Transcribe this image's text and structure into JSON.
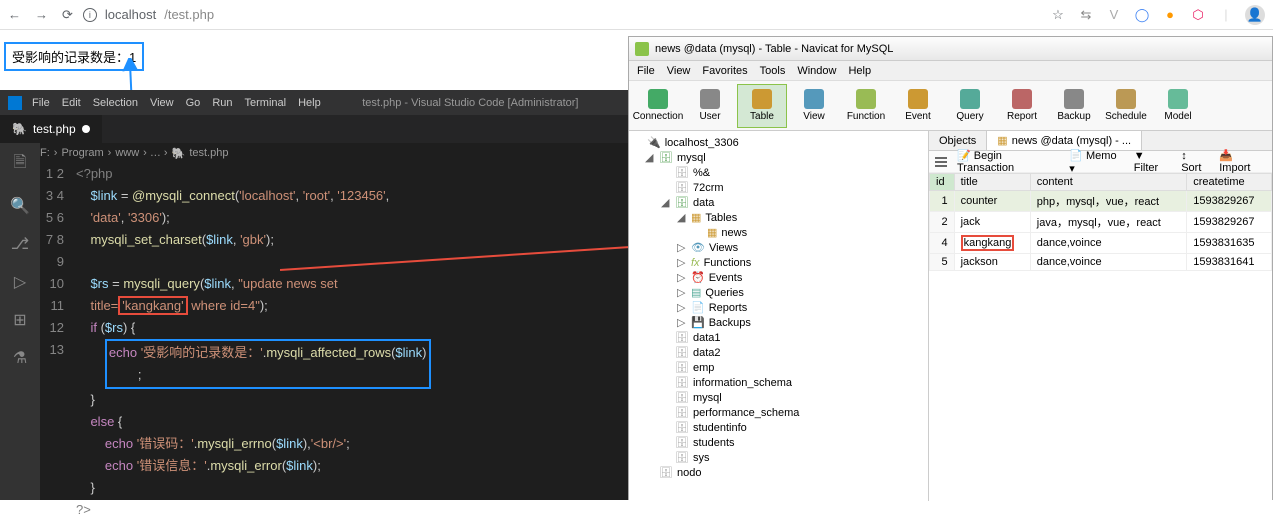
{
  "browser": {
    "url_host": "localhost",
    "url_path": "/test.php",
    "result_text": "受影响的记录数是：1"
  },
  "vscode": {
    "menu": [
      "File",
      "Edit",
      "Selection",
      "View",
      "Go",
      "Run",
      "Terminal",
      "Help"
    ],
    "title": "test.php - Visual Studio Code [Administrator]",
    "tab": "test.php",
    "breadcrumb": [
      "F:",
      "Program",
      "www",
      "",
      "test.php"
    ],
    "lines": {
      "l1": "<?php",
      "l2a": "$link",
      "l2b": " = ",
      "l2c": "@mysqli_connect",
      "l2d": "(",
      "l2s1": "'localhost'",
      "l2s2": "'root'",
      "l2s3": "'123456'",
      "l2x1": "'data'",
      "l2x2": "'3306'",
      "l2e": ");",
      "l3a": "mysqli_set_charset",
      "l3b": "(",
      "l3c": "$link",
      "l3d": ", ",
      "l3s": "'gbk'",
      "l3e": ");",
      "l5a": "$rs",
      "l5b": " = ",
      "l5c": "mysqli_query",
      "l5d": "(",
      "l5e": "$link",
      "l5f": ", ",
      "l5s": "\"update news set",
      "l5t1": "title=",
      "l5hl": "'kangkang'",
      "l5t2": " where id=4\"",
      "l5t3": ");",
      "l6a": "if",
      "l6b": " (",
      "l6c": "$rs",
      "l6d": ") {",
      "l7a": "echo ",
      "l7s": "'受影响的记录数是：'",
      "l7b": ".",
      "l7c": "mysqli_affected_rows",
      "l7d": "(",
      "l7e": "$link",
      "l7f": ")",
      "l7g": ";",
      "l8": "}",
      "l9a": "else",
      "l9b": " {",
      "l10a": "echo ",
      "l10s1": "'错误码：'",
      "l10b": ".",
      "l10c": "mysqli_errno",
      "l10d": "(",
      "l10e": "$link",
      "l10f": "),",
      "l10s2": "'<br/>'",
      "l10g": ";",
      "l11a": "echo ",
      "l11s": "'错误信息：'",
      "l11b": ".",
      "l11c": "mysqli_error",
      "l11d": "(",
      "l11e": "$link",
      "l11f": ");",
      "l12": "}",
      "l13": "?>"
    },
    "line_numbers": [
      "1",
      "2",
      "",
      "3",
      "4",
      "5",
      "",
      "6",
      "7",
      "",
      "8",
      "9",
      "10",
      "11",
      "12",
      "13"
    ]
  },
  "navicat": {
    "title": "news @data (mysql) - Table - Navicat for MySQL",
    "menu": [
      "File",
      "View",
      "Favorites",
      "Tools",
      "Window",
      "Help"
    ],
    "toolbar": [
      {
        "label": "Connection",
        "color": "#4a6"
      },
      {
        "label": "User",
        "color": "#888"
      },
      {
        "label": "Table",
        "color": "#c93",
        "active": true
      },
      {
        "label": "View",
        "color": "#59b"
      },
      {
        "label": "Function",
        "color": "#9b5"
      },
      {
        "label": "Event",
        "color": "#c93"
      },
      {
        "label": "Query",
        "color": "#5a9"
      },
      {
        "label": "Report",
        "color": "#b66"
      },
      {
        "label": "Backup",
        "color": "#888"
      },
      {
        "label": "Schedule",
        "color": "#b95"
      },
      {
        "label": "Model",
        "color": "#6b9"
      }
    ],
    "tree": {
      "root": "localhost_3306",
      "db1": "mysql",
      "db1_children": [
        "%&",
        "72crm"
      ],
      "db2": "data",
      "db2_folders": [
        "Tables",
        "Views",
        "Functions",
        "Events",
        "Queries",
        "Reports",
        "Backups"
      ],
      "db2_table": "news",
      "others": [
        "data1",
        "data2",
        "emp",
        "information_schema",
        "mysql",
        "performance_schema",
        "studentinfo",
        "students",
        "sys"
      ],
      "last": "nodo"
    },
    "tabs": {
      "objects": "Objects",
      "news": "news @data (mysql) - ..."
    },
    "obj_tools": {
      "begin": "Begin Transaction",
      "memo": "Memo",
      "filter": "Filter",
      "sort": "Sort",
      "import": "Import"
    },
    "grid": {
      "headers": [
        "id",
        "title",
        "content",
        "createtime"
      ],
      "rows": [
        {
          "id": "1",
          "title": "counter",
          "content": "php，mysql，vue，react",
          "createtime": "1593829267"
        },
        {
          "id": "2",
          "title": "jack",
          "content": "java，mysql，vue，react",
          "createtime": "1593829267"
        },
        {
          "id": "4",
          "title": "kangkang",
          "content": "dance,voince",
          "createtime": "1593831635",
          "highlight": true
        },
        {
          "id": "5",
          "title": "jackson",
          "content": "dance,voince",
          "createtime": "1593831641"
        }
      ]
    }
  },
  "watermark": ""
}
